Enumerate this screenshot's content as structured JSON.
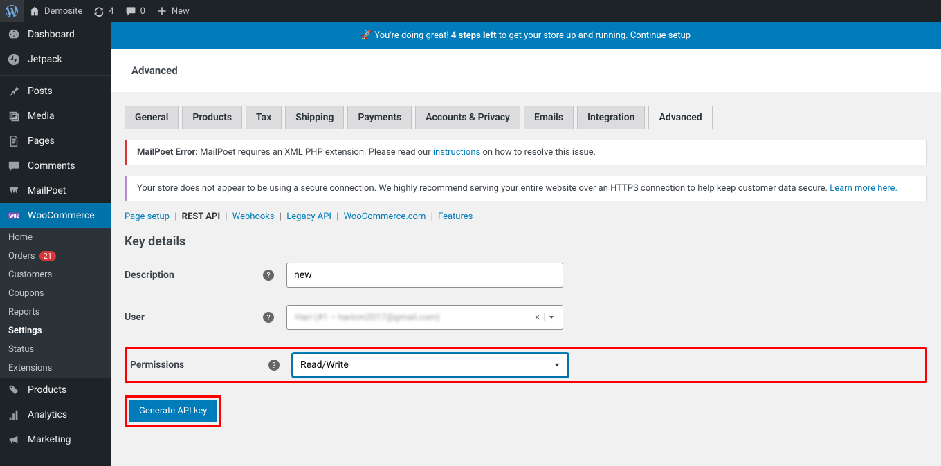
{
  "adminbar": {
    "site_name": "Demosite",
    "updates_count": "4",
    "comments_count": "0",
    "new_label": "New"
  },
  "sidebar": {
    "items": [
      {
        "label": "Dashboard"
      },
      {
        "label": "Jetpack"
      },
      {
        "label": "Posts"
      },
      {
        "label": "Media"
      },
      {
        "label": "Pages"
      },
      {
        "label": "Comments"
      },
      {
        "label": "MailPoet"
      },
      {
        "label": "WooCommerce"
      },
      {
        "label": "Products"
      },
      {
        "label": "Analytics"
      },
      {
        "label": "Marketing"
      }
    ],
    "woo_sub": [
      {
        "label": "Home"
      },
      {
        "label": "Orders",
        "badge": "21"
      },
      {
        "label": "Customers"
      },
      {
        "label": "Coupons"
      },
      {
        "label": "Reports"
      },
      {
        "label": "Settings"
      },
      {
        "label": "Status"
      },
      {
        "label": "Extensions"
      }
    ]
  },
  "banner": {
    "prefix": "🚀 You're doing great! ",
    "bold": "4 steps left",
    "mid": " to get your store up and running. ",
    "link": "Continue setup"
  },
  "page_title": "Advanced",
  "tabs": [
    "General",
    "Products",
    "Tax",
    "Shipping",
    "Payments",
    "Accounts & Privacy",
    "Emails",
    "Integration",
    "Advanced"
  ],
  "notices": {
    "mailpoet": {
      "strong": "MailPoet Error:",
      "text": " MailPoet requires an XML PHP extension. Please read our ",
      "link": "instructions",
      "after": " on how to resolve this issue."
    },
    "https": {
      "text": "Your store does not appear to be using a secure connection. We highly recommend serving your entire website over an HTTPS connection to help keep customer data secure. ",
      "link": "Learn more here."
    }
  },
  "subnav": [
    "Page setup",
    "REST API",
    "Webhooks",
    "Legacy API",
    "WooCommerce.com",
    "Features"
  ],
  "section_title": "Key details",
  "form": {
    "description_label": "Description",
    "description_value": "new",
    "user_label": "User",
    "user_value": "Hari (#1 – haricm2017@gmail.com)",
    "permissions_label": "Permissions",
    "permissions_value": "Read/Write",
    "generate_button": "Generate API key"
  }
}
